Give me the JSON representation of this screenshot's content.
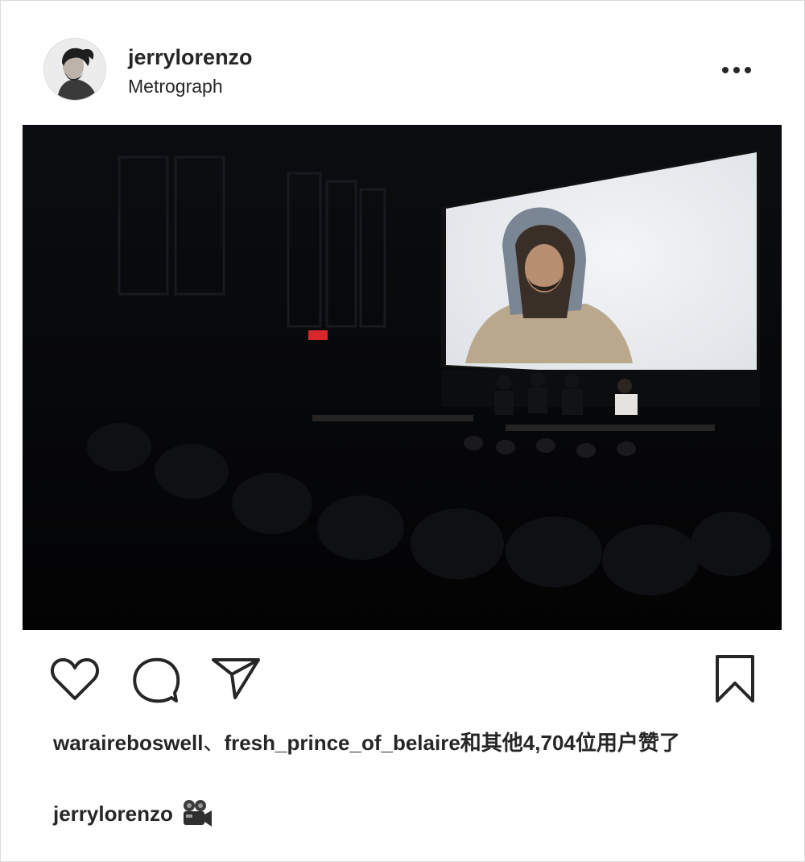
{
  "post": {
    "username": "jerrylorenzo",
    "location": "Metrograph"
  },
  "likes": {
    "user1": "waraireboswell",
    "separator": "、",
    "user2": "fresh_prince_of_belaire",
    "others_text": "和其他4,704位用户赞了"
  },
  "caption": {
    "username": "jerrylorenzo",
    "emoji_icon": "movie-camera-icon"
  },
  "icons": {
    "more": "more-horizontal-icon",
    "like": "heart-icon",
    "comment": "comment-icon",
    "share": "paper-plane-icon",
    "save": "bookmark-icon"
  },
  "colors": {
    "text": "#262626",
    "border": "#dbdbdb",
    "screen": "#e9ecef"
  }
}
